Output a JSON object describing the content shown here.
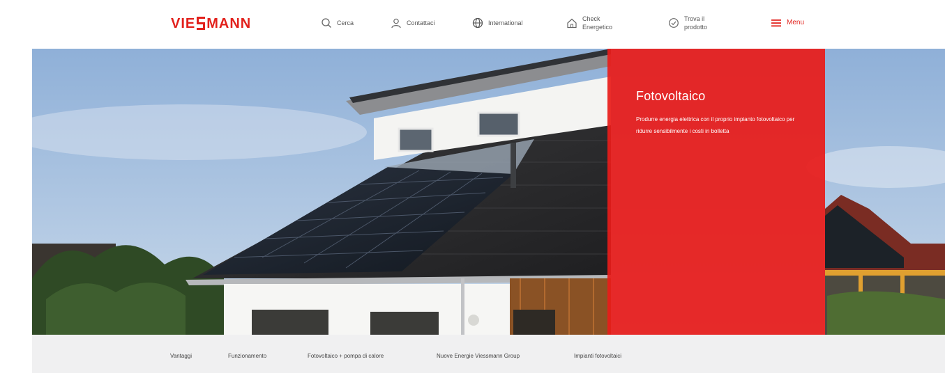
{
  "brand": {
    "logo_text_1": "VIE",
    "logo_text_2": "MANN",
    "color": "#e2211c"
  },
  "header": {
    "nav": [
      {
        "label": "Cerca",
        "icon": "search-icon"
      },
      {
        "label": "Contattaci",
        "icon": "user-icon"
      },
      {
        "label": "International",
        "icon": "globe-icon"
      },
      {
        "label": "Check\nEnergetico",
        "icon": "house-icon"
      },
      {
        "label": "Trova il\nprodotto",
        "icon": "check-circle-icon"
      },
      {
        "label": "Menu",
        "icon": "hamburger-icon"
      }
    ]
  },
  "hero": {
    "title": "Fotovoltaico",
    "text": "Produrre energia elettrica con il proprio impianto fotovoltaico per ridurre sensibilmente i costi in bolletta",
    "panel_color": "#e81c1a"
  },
  "subnav": {
    "items": [
      "Vantaggi",
      "Funzionamento",
      "Fotovoltaico + pompa di calore",
      "Nuove Energie Viessmann Group",
      "Impianti fotovoltaici"
    ]
  }
}
